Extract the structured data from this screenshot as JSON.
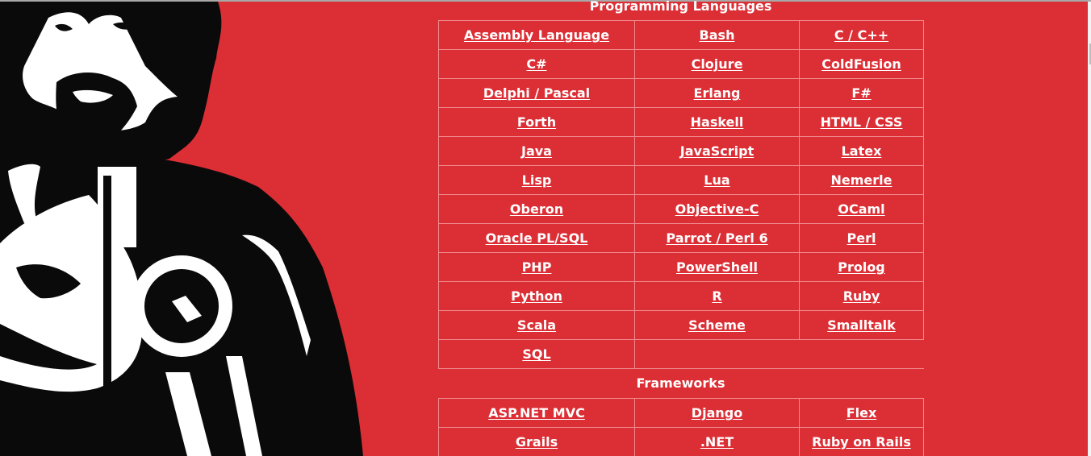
{
  "sections": [
    {
      "title": "Programming Languages",
      "rows": [
        [
          "Assembly Language",
          "Bash",
          "C / C++"
        ],
        [
          "C#",
          "Clojure",
          "ColdFusion"
        ],
        [
          "Delphi / Pascal",
          "Erlang",
          "F#"
        ],
        [
          "Forth",
          "Haskell",
          "HTML / CSS"
        ],
        [
          "Java",
          "JavaScript",
          "Latex"
        ],
        [
          "Lisp",
          "Lua",
          "Nemerle"
        ],
        [
          "Oberon",
          "Objective-C",
          "OCaml"
        ],
        [
          "Oracle PL/SQL",
          "Parrot / Perl 6",
          "Perl"
        ],
        [
          "PHP",
          "PowerShell",
          "Prolog"
        ],
        [
          "Python",
          "R",
          "Ruby"
        ],
        [
          "Scala",
          "Scheme",
          "Smalltalk"
        ],
        [
          "SQL"
        ]
      ]
    },
    {
      "title": "Frameworks",
      "rows": [
        [
          "ASP.NET MVC",
          "Django",
          "Flex"
        ],
        [
          "Grails",
          ".NET",
          "Ruby on Rails"
        ]
      ]
    }
  ],
  "illustration": {
    "subject": "stencil-man-pointing-revolver",
    "colors": {
      "background": "#dc2e35",
      "ink": "#0a0a0a",
      "highlight": "#ffffff"
    }
  },
  "theme": {
    "background": "#dc2e35",
    "cell_border": "#f08a8e",
    "link": "#ffffff"
  }
}
